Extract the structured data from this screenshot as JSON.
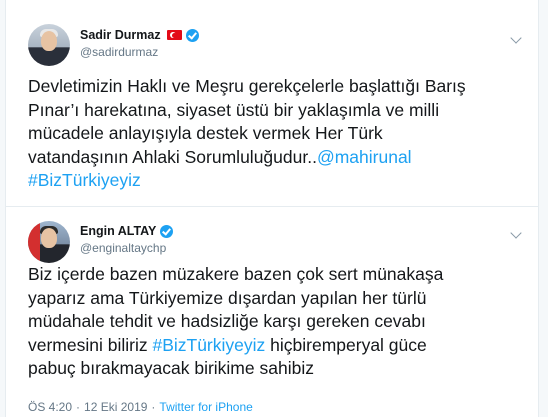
{
  "tweet1": {
    "display_name": "Sadir Durmaz",
    "handle": "@sadirdurmaz",
    "text_lines": [
      "Devletimizin Haklı ve Meşru gerekçelerle başlattığı Barış",
      "Pınar’ı harekatına, siyaset üstü bir yaklaşımla ve milli",
      "mücadele anlayışıyla destek vermek Her Türk",
      "vatandaşının Ahlaki Sorumluluğudur.."
    ],
    "mention": "@mahirunal",
    "hashtag": "#BizTürkiyeyiz"
  },
  "tweet2": {
    "display_name": "Engin ALTAY",
    "handle": "@enginaltaychp",
    "text_lines": [
      "Biz içerde bazen müzakere bazen çok sert münakaşa",
      "yaparız ama Türkiyemize dışardan yapılan her türlü",
      "müdahale tehdit ve hadsizliğe karşı  gereken cevabı",
      "vermesini biliriz ",
      "pabuç bırakmayacak birikime sahibiz"
    ],
    "hashtag": "#BizTürkiyeyiz",
    "after_hashtag": " hiçbiremperyal güce",
    "time": "ÖS 4:20",
    "separator": "·",
    "date": "12 Eki 2019",
    "source": "Twitter for iPhone"
  },
  "icons": {
    "verified": "verified-badge-icon",
    "flag": "turkey-flag-icon",
    "caret": "chevron-down-icon"
  },
  "colors": {
    "link": "#1da1f2",
    "text": "#14171a",
    "secondary": "#657786"
  }
}
